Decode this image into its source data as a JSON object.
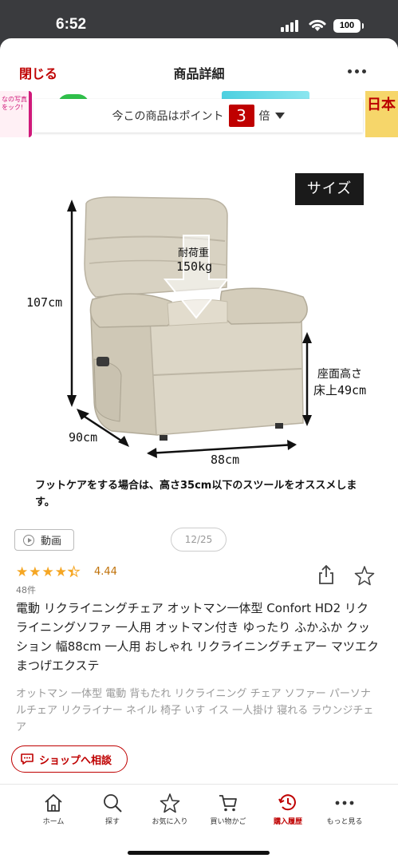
{
  "status": {
    "time": "6:52",
    "battery": "100"
  },
  "nav": {
    "close": "閉じる",
    "title": "商品詳細"
  },
  "banner": {
    "left_text": "なの写真をック!",
    "right_text": "日本",
    "points_prefix": "今この商品はポイント",
    "points_multiplier": "3",
    "points_suffix": "倍"
  },
  "image": {
    "size_tag": "サイズ",
    "load_label": "耐荷重",
    "load_value": "150kg",
    "height": "107cm",
    "depth": "90cm",
    "width": "88cm",
    "seat_label": "座面高さ",
    "seat_value": "床上49cm",
    "footcare_note": "フットケアをする場合は、高さ35cm以下のスツールをオススメします。"
  },
  "media": {
    "video_label": "動画",
    "pager": "12/25"
  },
  "rating": {
    "value": "4.44",
    "stars": 4.44,
    "count": "48件"
  },
  "product": {
    "title": "電動 リクライニングチェア オットマン一体型 Confort HD2 リクライニングソファ 一人用 オットマン付き ゆったり ふかふか クッション 幅88cm 一人用 おしゃれ リクライニングチェアー マツエク まつげエクステ",
    "tags": "オットマン 一体型 電動 背もたれ リクライニング チェア ソファー パーソナルチェア リクライナー ネイル 椅子 いす イス 一人掛け 寝れる ラウンジチェア"
  },
  "shop_button": "ショップへ相談",
  "tabbar": [
    {
      "icon": "home-icon",
      "label": "ホーム"
    },
    {
      "icon": "search-icon",
      "label": "探す"
    },
    {
      "icon": "star-icon",
      "label": "お気に入り"
    },
    {
      "icon": "cart-icon",
      "label": "買い物かご"
    },
    {
      "icon": "history-icon",
      "label": "購入履歴",
      "active": true
    },
    {
      "icon": "more-icon",
      "label": "もっと見る"
    }
  ],
  "colors": {
    "brand_red": "#bf0000",
    "star": "#f5a623",
    "chair": "#d8d2c2"
  }
}
